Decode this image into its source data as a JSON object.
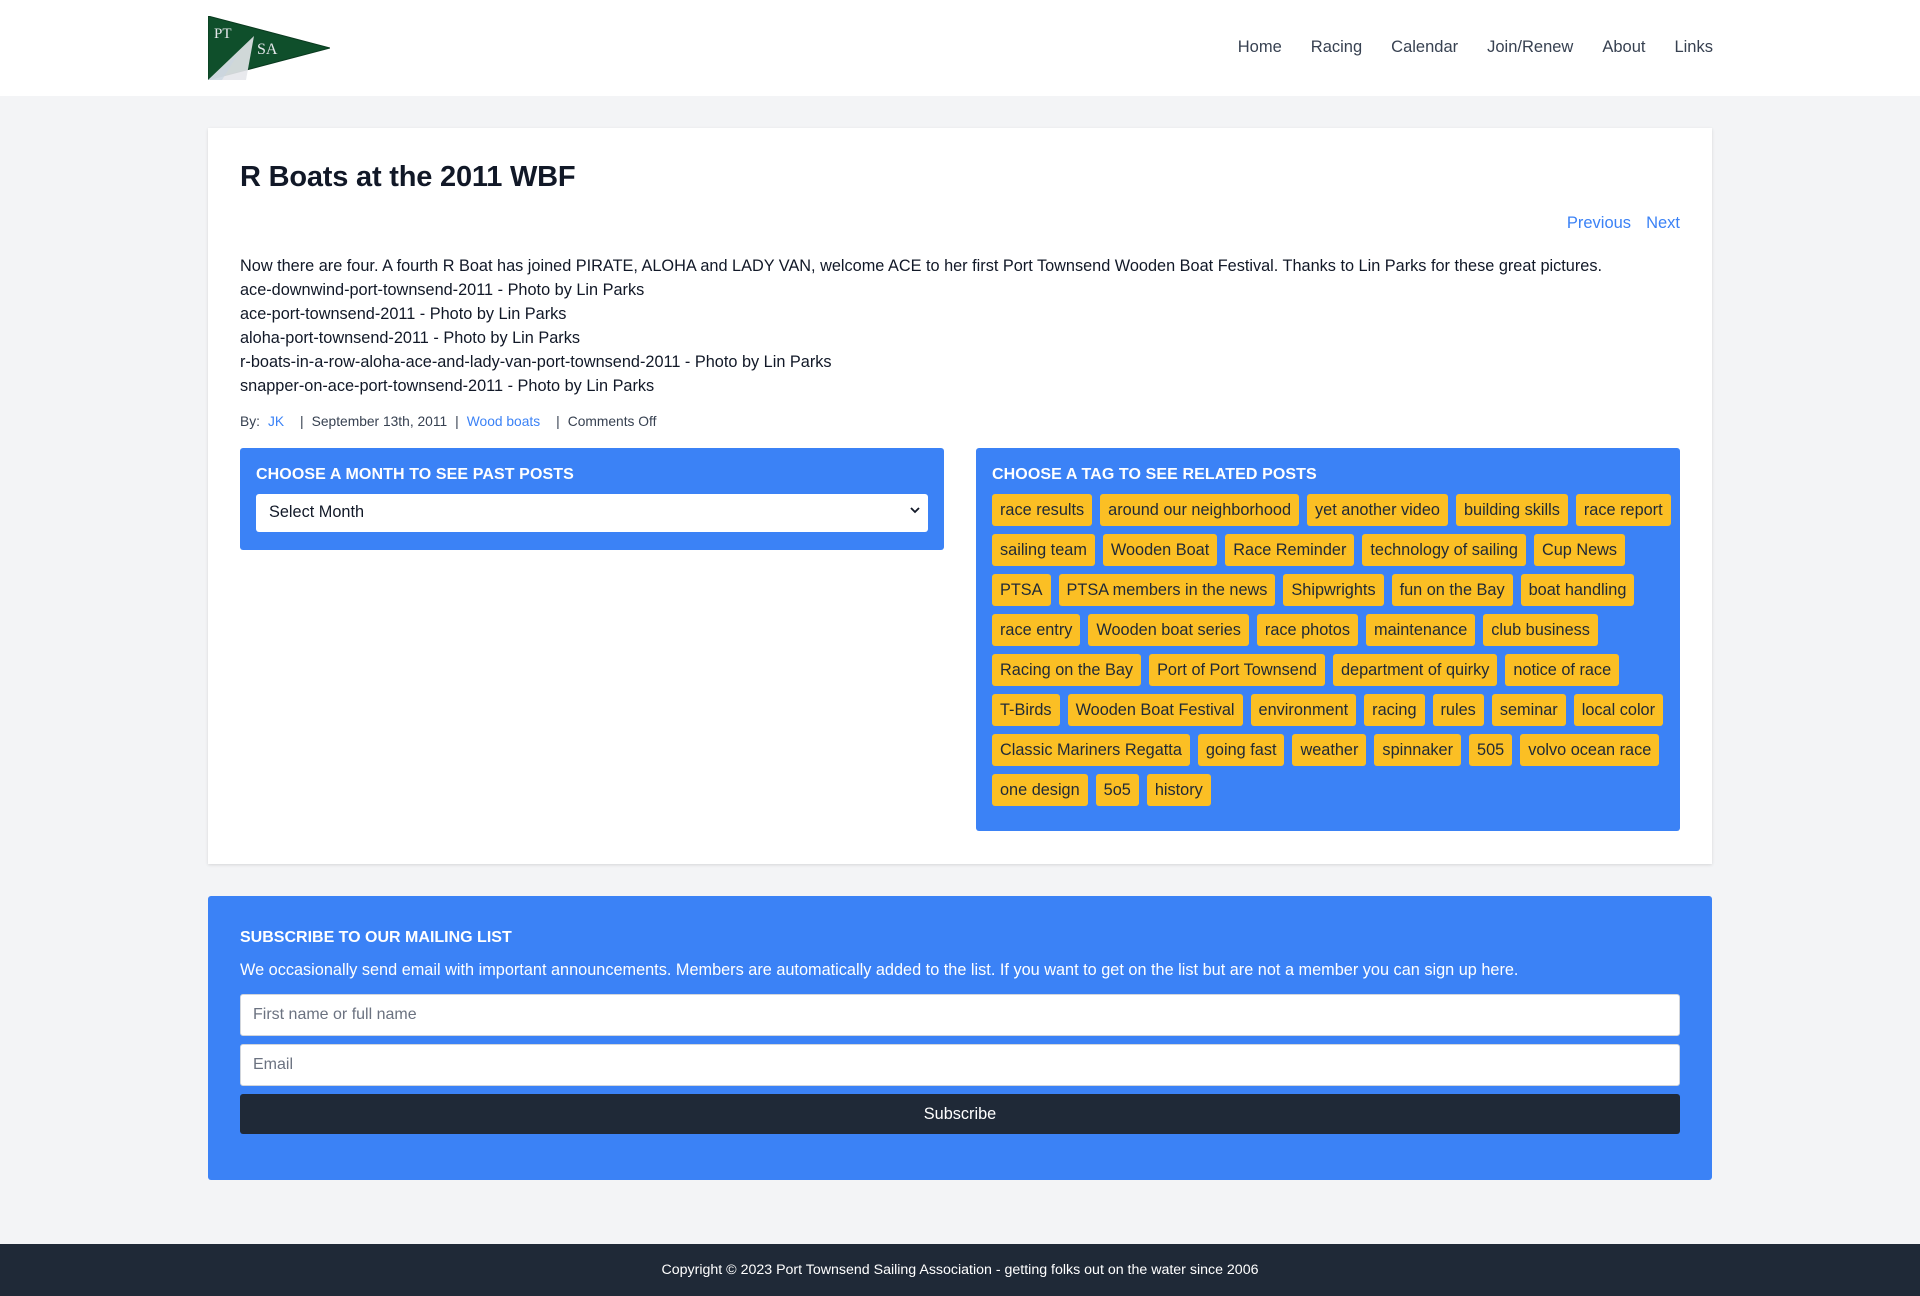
{
  "logo": {
    "text_top": "PT",
    "text_bottom": "SA",
    "colors": {
      "pennant": "#0f4f2b",
      "sail": "#e5e7eb"
    }
  },
  "nav": {
    "items": [
      {
        "label": "Home"
      },
      {
        "label": "Racing"
      },
      {
        "label": "Calendar"
      },
      {
        "label": "Join/Renew"
      },
      {
        "label": "About"
      },
      {
        "label": "Links"
      }
    ]
  },
  "post": {
    "title": "R Boats at the 2011 WBF",
    "previous_label": "Previous",
    "next_label": "Next",
    "body": [
      "Now there are four. A fourth R Boat has joined PIRATE, ALOHA and LADY VAN, welcome ACE to her first Port Townsend Wooden Boat Festival. Thanks to Lin Parks for these great pictures.",
      "ace-downwind-port-townsend-2011 - Photo by Lin Parks",
      "ace-port-townsend-2011 - Photo by Lin Parks",
      "aloha-port-townsend-2011 - Photo by Lin Parks",
      "r-boats-in-a-row-aloha-ace-and-lady-van-port-townsend-2011 - Photo by Lin Parks",
      "snapper-on-ace-port-townsend-2011 - Photo by Lin Parks"
    ],
    "meta": {
      "by_label": "By:",
      "author": "JK",
      "date": "September 13th, 2011",
      "category": "Wood boats",
      "comments": "Comments Off",
      "separator": "|"
    }
  },
  "archive_widget": {
    "title": "Choose a month to see past posts",
    "select_value": "Select Month"
  },
  "tags_widget": {
    "title": "Choose a tag to see related posts",
    "tags": [
      "race results",
      "around our neighborhood",
      "yet another video",
      "building skills",
      "race report",
      "sailing team",
      "Wooden Boat",
      "Race Reminder",
      "technology of sailing",
      "Cup News",
      "PTSA",
      "PTSA members in the news",
      "Shipwrights",
      "fun on the Bay",
      "boat handling",
      "race entry",
      "Wooden boat series",
      "race photos",
      "maintenance",
      "club business",
      "Racing on the Bay",
      "Port of Port Townsend",
      "department of quirky",
      "notice of race",
      "T-Birds",
      "Wooden Boat Festival",
      "environment",
      "racing",
      "rules",
      "seminar",
      "local color",
      "Classic Mariners Regatta",
      "going fast",
      "weather",
      "spinnaker",
      "505",
      "volvo ocean race",
      "one design",
      "5o5",
      "history"
    ]
  },
  "subscribe": {
    "title": "Subscribe to our mailing list",
    "description": "We occasionally send email with important announcements. Members are automatically added to the list. If you want to get on the list but are not a member you can sign up here.",
    "name_placeholder": "First name or full name",
    "email_placeholder": "Email",
    "button_label": "Subscribe"
  },
  "footer": {
    "text": "Copyright © 2023 Port Townsend Sailing Association - getting folks out on the water since 2006"
  },
  "colors": {
    "accent": "#3b82f6",
    "tag": "#fbbf24",
    "dark": "#1f2937",
    "page_bg": "#f3f4f6"
  }
}
